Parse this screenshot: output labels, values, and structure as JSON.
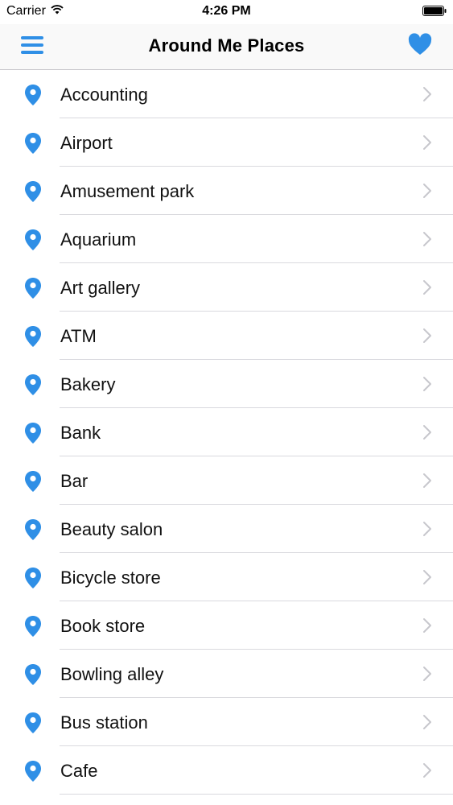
{
  "status_bar": {
    "carrier": "Carrier",
    "time": "4:26 PM"
  },
  "nav": {
    "title": "Around Me Places",
    "accent_color": "#2f8fe6"
  },
  "places": [
    {
      "label": "Accounting"
    },
    {
      "label": "Airport"
    },
    {
      "label": "Amusement park"
    },
    {
      "label": "Aquarium"
    },
    {
      "label": "Art gallery"
    },
    {
      "label": "ATM"
    },
    {
      "label": "Bakery"
    },
    {
      "label": "Bank"
    },
    {
      "label": "Bar"
    },
    {
      "label": "Beauty salon"
    },
    {
      "label": "Bicycle store"
    },
    {
      "label": "Book store"
    },
    {
      "label": "Bowling alley"
    },
    {
      "label": "Bus station"
    },
    {
      "label": "Cafe"
    }
  ]
}
